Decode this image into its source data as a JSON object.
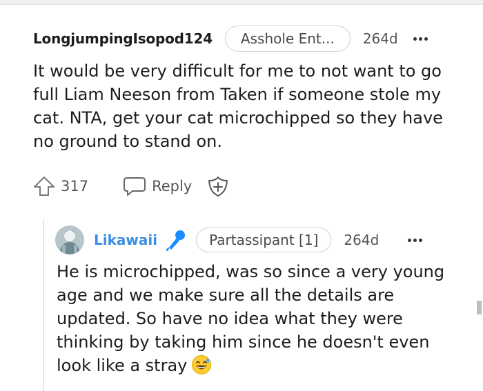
{
  "comment": {
    "username": "LongjumpingIsopod124",
    "flair": "Asshole Ent...",
    "age": "264d",
    "body": "It would be very difficult for me to not want to go full Liam Neeson from Taken if someone stole my cat. NTA, get your cat microchipped so they have no ground to stand on.",
    "votes": "317",
    "reply_label": "Reply",
    "icons": {
      "upvote": "upvote-arrow-icon",
      "reply": "speech-bubble-icon",
      "award": "add-award-icon",
      "more": "more-options-icon"
    }
  },
  "reply": {
    "username": "Likawaii",
    "flair": "Partassipant [1]",
    "age": "264d",
    "body": "He is microchipped, was so since a very young age and we make sure all the details are updated. So have no idea what they were thinking by taking him since he doesn't even look like a stray",
    "emoji": "😅",
    "icons": {
      "avatar": "user-avatar",
      "mic": "microphone-icon",
      "more": "more-options-icon"
    }
  },
  "colors": {
    "username_reply": "#3d8ee0",
    "mic_blue": "#1a8cff",
    "text": "#1c1c1c",
    "muted": "#555555",
    "border": "#cfcfcf"
  }
}
